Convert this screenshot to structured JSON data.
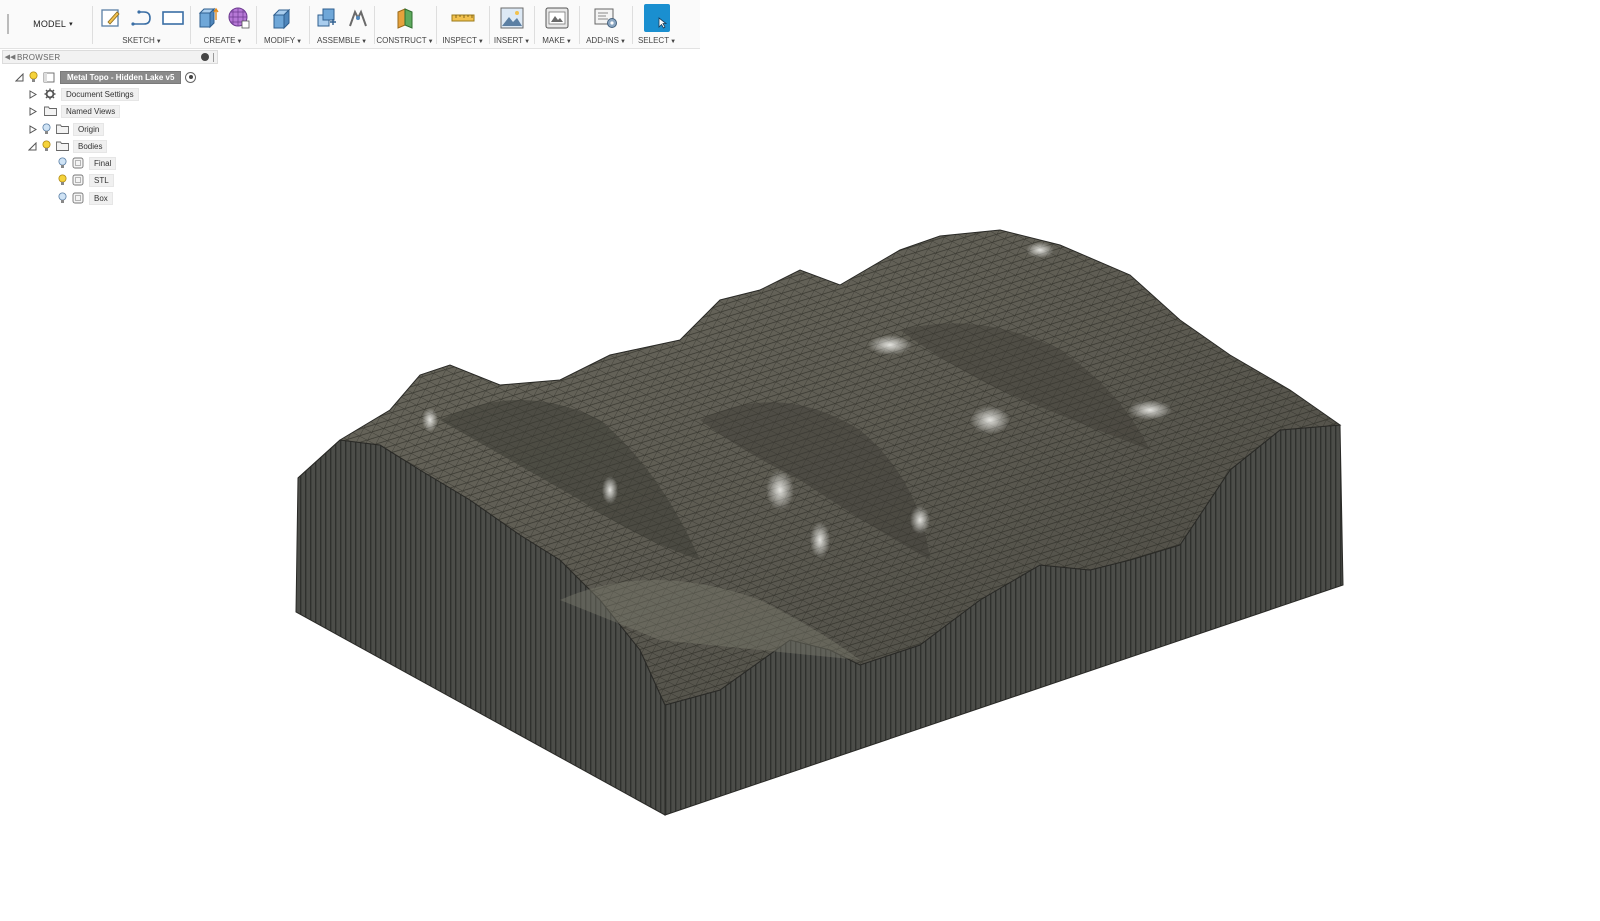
{
  "toolbar": {
    "workspace": "MODEL",
    "groups": {
      "sketch": "SKETCH",
      "create": "CREATE",
      "modify": "MODIFY",
      "assemble": "ASSEMBLE",
      "construct": "CONSTRUCT",
      "inspect": "INSPECT",
      "insert": "INSERT",
      "make": "MAKE",
      "addins": "ADD-INS",
      "select": "SELECT"
    },
    "accent_color": "#1a8fd0"
  },
  "browser": {
    "title": "BROWSER",
    "root": "Metal Topo - Hidden Lake v5",
    "items": [
      "Document Settings",
      "Named Views",
      "Origin",
      "Bodies"
    ],
    "bodies": [
      "Final",
      "STL",
      "Box"
    ]
  },
  "icons": {
    "collapse": "double-chevron-left-icon",
    "settings": "gear-icon",
    "folder": "folder-icon",
    "body": "body-icon",
    "visibility": "lightbulb-icon"
  }
}
